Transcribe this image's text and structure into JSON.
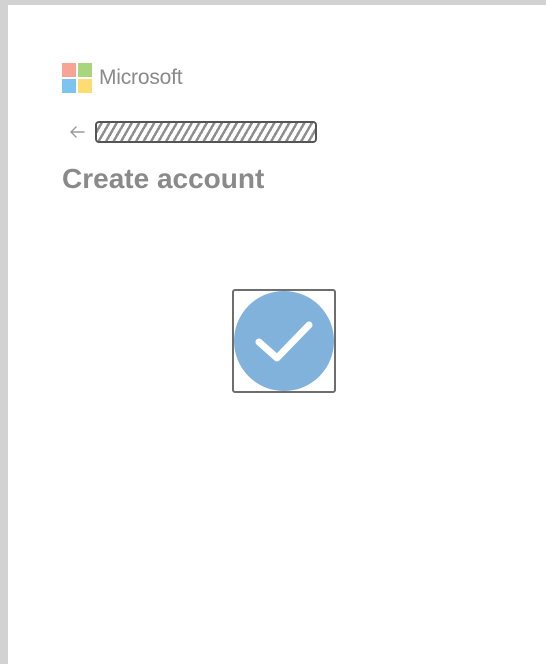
{
  "brand": {
    "name": "Microsoft",
    "tile_colors": [
      "#f7a495",
      "#a9d57c",
      "#7ec4f0",
      "#fddc73"
    ]
  },
  "nav": {
    "back_icon": "back-arrow-icon",
    "identity_value": ""
  },
  "main": {
    "title": "Create account",
    "status_icon": "checkmark-circle-icon",
    "status_color": "#80b2dc"
  }
}
